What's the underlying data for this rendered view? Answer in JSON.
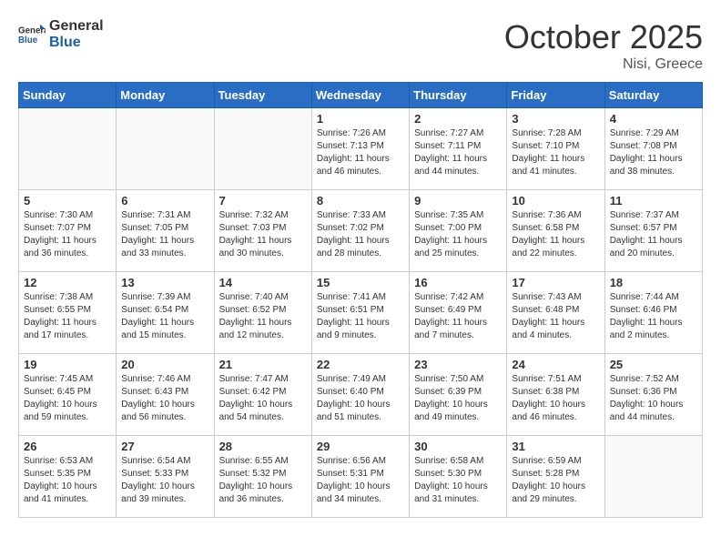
{
  "header": {
    "logo_general": "General",
    "logo_blue": "Blue",
    "month_year": "October 2025",
    "location": "Nisi, Greece"
  },
  "weekdays": [
    "Sunday",
    "Monday",
    "Tuesday",
    "Wednesday",
    "Thursday",
    "Friday",
    "Saturday"
  ],
  "weeks": [
    [
      {
        "day": "",
        "info": "",
        "empty": true
      },
      {
        "day": "",
        "info": "",
        "empty": true
      },
      {
        "day": "",
        "info": "",
        "empty": true
      },
      {
        "day": "1",
        "info": "Sunrise: 7:26 AM\nSunset: 7:13 PM\nDaylight: 11 hours\nand 46 minutes."
      },
      {
        "day": "2",
        "info": "Sunrise: 7:27 AM\nSunset: 7:11 PM\nDaylight: 11 hours\nand 44 minutes."
      },
      {
        "day": "3",
        "info": "Sunrise: 7:28 AM\nSunset: 7:10 PM\nDaylight: 11 hours\nand 41 minutes."
      },
      {
        "day": "4",
        "info": "Sunrise: 7:29 AM\nSunset: 7:08 PM\nDaylight: 11 hours\nand 38 minutes."
      }
    ],
    [
      {
        "day": "5",
        "info": "Sunrise: 7:30 AM\nSunset: 7:07 PM\nDaylight: 11 hours\nand 36 minutes."
      },
      {
        "day": "6",
        "info": "Sunrise: 7:31 AM\nSunset: 7:05 PM\nDaylight: 11 hours\nand 33 minutes."
      },
      {
        "day": "7",
        "info": "Sunrise: 7:32 AM\nSunset: 7:03 PM\nDaylight: 11 hours\nand 30 minutes."
      },
      {
        "day": "8",
        "info": "Sunrise: 7:33 AM\nSunset: 7:02 PM\nDaylight: 11 hours\nand 28 minutes."
      },
      {
        "day": "9",
        "info": "Sunrise: 7:35 AM\nSunset: 7:00 PM\nDaylight: 11 hours\nand 25 minutes."
      },
      {
        "day": "10",
        "info": "Sunrise: 7:36 AM\nSunset: 6:58 PM\nDaylight: 11 hours\nand 22 minutes."
      },
      {
        "day": "11",
        "info": "Sunrise: 7:37 AM\nSunset: 6:57 PM\nDaylight: 11 hours\nand 20 minutes."
      }
    ],
    [
      {
        "day": "12",
        "info": "Sunrise: 7:38 AM\nSunset: 6:55 PM\nDaylight: 11 hours\nand 17 minutes."
      },
      {
        "day": "13",
        "info": "Sunrise: 7:39 AM\nSunset: 6:54 PM\nDaylight: 11 hours\nand 15 minutes."
      },
      {
        "day": "14",
        "info": "Sunrise: 7:40 AM\nSunset: 6:52 PM\nDaylight: 11 hours\nand 12 minutes."
      },
      {
        "day": "15",
        "info": "Sunrise: 7:41 AM\nSunset: 6:51 PM\nDaylight: 11 hours\nand 9 minutes."
      },
      {
        "day": "16",
        "info": "Sunrise: 7:42 AM\nSunset: 6:49 PM\nDaylight: 11 hours\nand 7 minutes."
      },
      {
        "day": "17",
        "info": "Sunrise: 7:43 AM\nSunset: 6:48 PM\nDaylight: 11 hours\nand 4 minutes."
      },
      {
        "day": "18",
        "info": "Sunrise: 7:44 AM\nSunset: 6:46 PM\nDaylight: 11 hours\nand 2 minutes."
      }
    ],
    [
      {
        "day": "19",
        "info": "Sunrise: 7:45 AM\nSunset: 6:45 PM\nDaylight: 10 hours\nand 59 minutes."
      },
      {
        "day": "20",
        "info": "Sunrise: 7:46 AM\nSunset: 6:43 PM\nDaylight: 10 hours\nand 56 minutes."
      },
      {
        "day": "21",
        "info": "Sunrise: 7:47 AM\nSunset: 6:42 PM\nDaylight: 10 hours\nand 54 minutes."
      },
      {
        "day": "22",
        "info": "Sunrise: 7:49 AM\nSunset: 6:40 PM\nDaylight: 10 hours\nand 51 minutes."
      },
      {
        "day": "23",
        "info": "Sunrise: 7:50 AM\nSunset: 6:39 PM\nDaylight: 10 hours\nand 49 minutes."
      },
      {
        "day": "24",
        "info": "Sunrise: 7:51 AM\nSunset: 6:38 PM\nDaylight: 10 hours\nand 46 minutes."
      },
      {
        "day": "25",
        "info": "Sunrise: 7:52 AM\nSunset: 6:36 PM\nDaylight: 10 hours\nand 44 minutes."
      }
    ],
    [
      {
        "day": "26",
        "info": "Sunrise: 6:53 AM\nSunset: 5:35 PM\nDaylight: 10 hours\nand 41 minutes."
      },
      {
        "day": "27",
        "info": "Sunrise: 6:54 AM\nSunset: 5:33 PM\nDaylight: 10 hours\nand 39 minutes."
      },
      {
        "day": "28",
        "info": "Sunrise: 6:55 AM\nSunset: 5:32 PM\nDaylight: 10 hours\nand 36 minutes."
      },
      {
        "day": "29",
        "info": "Sunrise: 6:56 AM\nSunset: 5:31 PM\nDaylight: 10 hours\nand 34 minutes."
      },
      {
        "day": "30",
        "info": "Sunrise: 6:58 AM\nSunset: 5:30 PM\nDaylight: 10 hours\nand 31 minutes."
      },
      {
        "day": "31",
        "info": "Sunrise: 6:59 AM\nSunset: 5:28 PM\nDaylight: 10 hours\nand 29 minutes."
      },
      {
        "day": "",
        "info": "",
        "empty": true
      }
    ]
  ]
}
